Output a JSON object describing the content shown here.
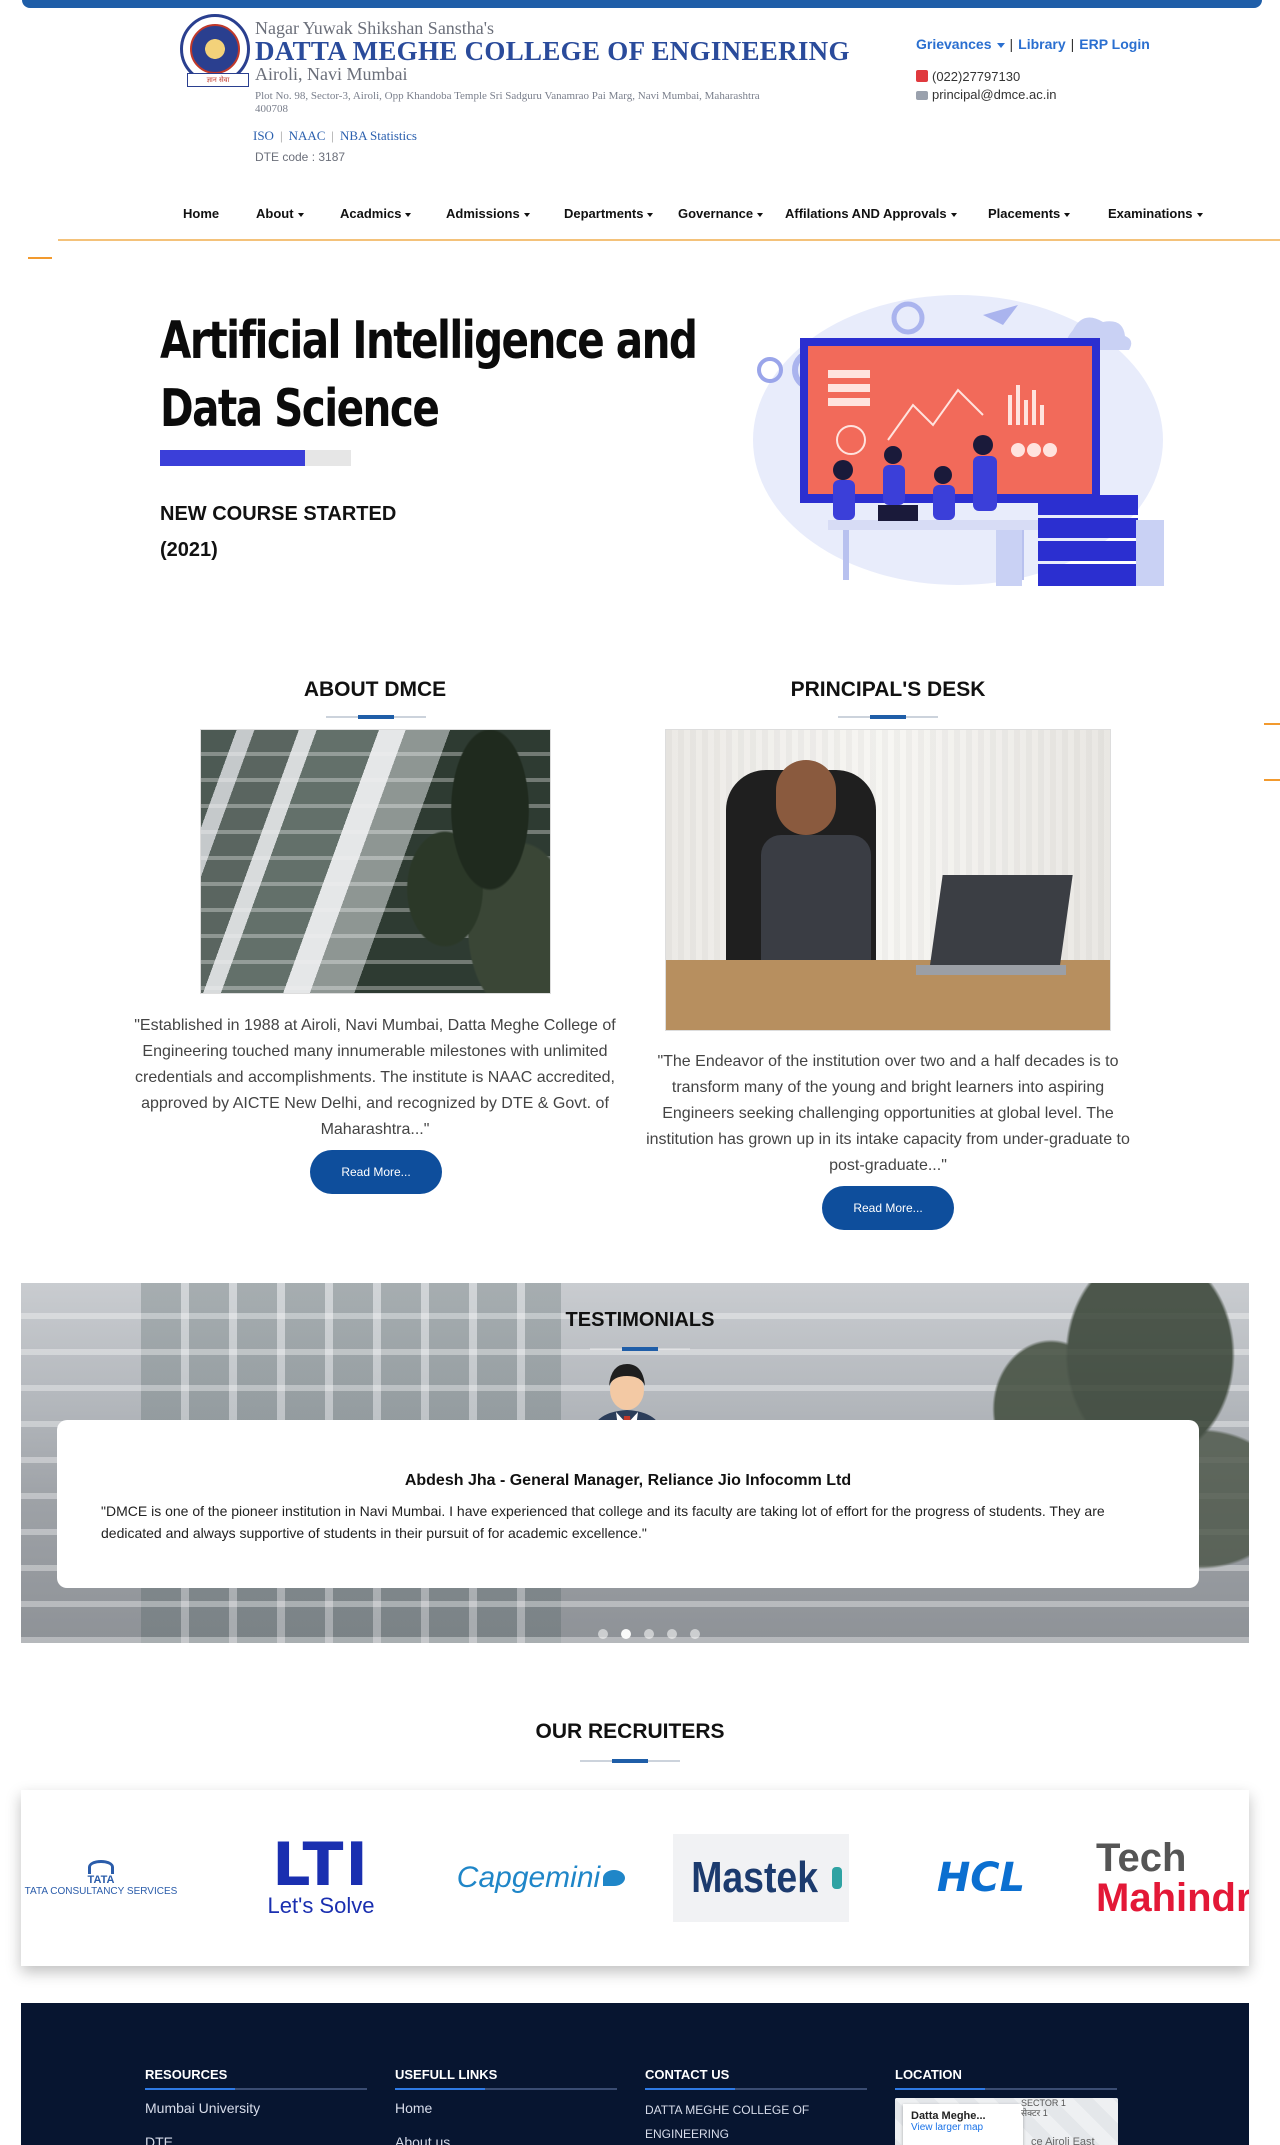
{
  "header": {
    "logo_ribbon": "ज्ञान सेवा",
    "sanstha": "Nagar Yuwak Shikshan Sanstha's",
    "college": "DATTA MEGHE COLLEGE OF ENGINEERING",
    "city": "Airoli, Navi Mumbai",
    "address": "Plot No. 98, Sector-3, Airoli, Opp Khandoba Temple Sri Sadguru Vanamrao Pai Marg, Navi Mumbai, Maharashtra 400708",
    "accreditations": [
      "ISO",
      "NAAC",
      "NBA Statistics"
    ],
    "dte_code": "DTE code : 3187",
    "quick_links": {
      "grievances": "Grievances",
      "library": "Library",
      "erp": "ERP Login"
    },
    "phone": "(022)27797130",
    "email": "principal@dmce.ac.in"
  },
  "nav": [
    "Home",
    "About",
    "Acadmics",
    "Admissions",
    "Departments",
    "Governance",
    "Affilations AND Approvals",
    "Placements",
    "Examinations"
  ],
  "hero": {
    "title_line1": "Artificial Intelligence and",
    "title_line2": "Data Science",
    "subtitle_line1": "NEW COURSE STARTED",
    "subtitle_line2": "(2021)"
  },
  "about": {
    "title": "ABOUT DMCE",
    "text": "\"Established in 1988 at Airoli, Navi Mumbai, Datta Meghe College of Engineering touched many innumerable milestones with unlimited credentials and accomplishments. The institute is NAAC accredited, approved by AICTE New Delhi, and recognized by DTE & Govt. of Maharashtra...\"",
    "button": "Read More..."
  },
  "principal": {
    "title": "PRINCIPAL'S DESK",
    "text": "\"The Endeavor of the institution over two and a half decades is to transform many of the young and bright learners into aspiring Engineers seeking challenging opportunities at global level. The institution has grown up in its intake capacity from under-graduate to post-graduate...\"",
    "button": "Read More..."
  },
  "testimonials": {
    "title": "TESTIMONIALS",
    "name": "Abdesh Jha - General Manager, Reliance Jio Infocomm Ltd",
    "quote": "\"DMCE is one of the pioneer institution in Navi Mumbai. I have experienced that college and its faculty are taking lot of effort for the progress of students. They are dedicated and always supportive of students in their pursuit of for academic excellence.\""
  },
  "recruiters": {
    "title": "OUR RECRUITERS",
    "tcs_brand": "TATA",
    "tcs_name": "TATA CONSULTANCY SERVICES",
    "lti": "LTI",
    "lti_tag": "Let's Solve",
    "capgemini": "Capgemini",
    "mastek": "Mastek",
    "hcl": "HCL",
    "tech": "Tech",
    "mahindra": "Mahindra"
  },
  "footer": {
    "resources_title": "RESOURCES",
    "resources": [
      "Mumbai University",
      "DTE"
    ],
    "links_title": "USEFULL LINKS",
    "links": [
      "Home",
      "About us"
    ],
    "contact_title": "CONTACT US",
    "contact_line1": "DATTA MEGHE COLLEGE OF",
    "contact_line2": "ENGINEERING",
    "location_title": "LOCATION",
    "map_title": "Datta Meghe...",
    "map_link": "View larger map",
    "map_label1": "SECTOR 1",
    "map_label2": "सेक्टर 1",
    "map_label3": "ce Airoli East"
  },
  "colors": {
    "brand_blue": "#1f5ea8",
    "button_blue": "#0e4e9c",
    "hero_accent": "#3b3fd9",
    "nav_underline": "#f4c27a",
    "footer_bg": "#071530"
  }
}
